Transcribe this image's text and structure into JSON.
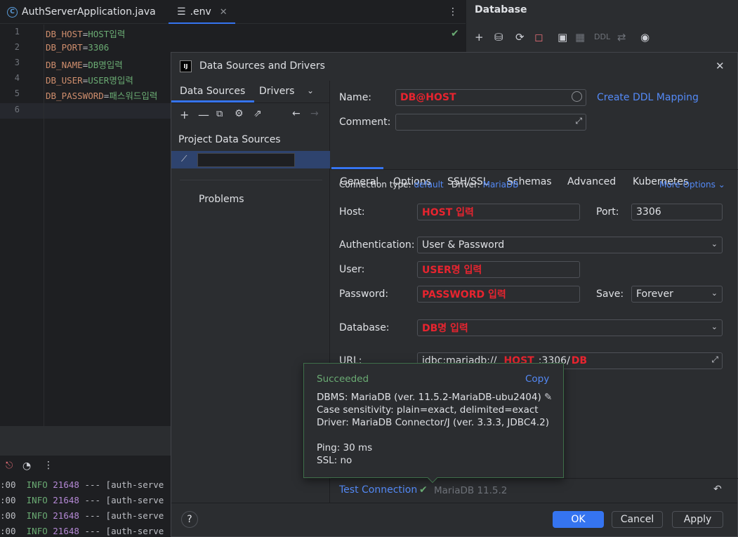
{
  "editor": {
    "tabs": [
      {
        "label": "AuthServerApplication.java"
      },
      {
        "label": ".env"
      }
    ],
    "lines": [
      {
        "num": "1",
        "key": "DB_HOST",
        "val": "HOST입력"
      },
      {
        "num": "2",
        "key": "DB_PORT",
        "val": "3306"
      },
      {
        "num": "3",
        "key": "DB_NAME",
        "val": "DB명입력"
      },
      {
        "num": "4",
        "key": "DB_USER",
        "val": "USER명입력"
      },
      {
        "num": "5",
        "key": "DB_PASSWORD",
        "val": "패스워드입력"
      },
      {
        "num": "6",
        "key": "",
        "val": ""
      }
    ],
    "eq": "="
  },
  "right_panel": {
    "title": "Database",
    "ddl": "DDL"
  },
  "log": [
    {
      "time": ":00",
      "level": "INFO",
      "pid": "21648",
      "rest": " --- [auth-serve"
    },
    {
      "time": ":00",
      "level": "INFO",
      "pid": "21648",
      "rest": " --- [auth-serve"
    },
    {
      "time": ":00",
      "level": "INFO",
      "pid": "21648",
      "rest": " --- [auth-serve"
    },
    {
      "time": ":00",
      "level": "INFO",
      "pid": "21648",
      "rest": " --- [auth-serve"
    }
  ],
  "dialog": {
    "title": "Data Sources and Drivers",
    "left": {
      "tab_sources": "Data Sources",
      "tab_drivers": "Drivers",
      "project_label": "Project Data Sources",
      "problems": "Problems"
    },
    "name_label": "Name:",
    "name_value": "DB@HOST",
    "create_ddl": "Create DDL Mapping",
    "comment_label": "Comment:",
    "tabs": [
      "General",
      "Options",
      "SSH/SSL",
      "Schemas",
      "Advanced",
      "Kubernetes"
    ],
    "conn_type_label": "Connection type:",
    "conn_type_value": "default",
    "driver_label": "Driver:",
    "driver_value": "MariaDB",
    "more_options": "More Options",
    "host_label": "Host:",
    "host_value": "HOST 입력",
    "port_label": "Port:",
    "port_value": "3306",
    "auth_label": "Authentication:",
    "auth_value": "User & Password",
    "user_label": "User:",
    "user_value": "USER명 입력",
    "password_label": "Password:",
    "password_value": "PASSWORD 입력",
    "save_label": "Save:",
    "save_value": "Forever",
    "database_label": "Database:",
    "database_value": "DB명 입력",
    "url_label": "URL:",
    "url_prefix": "jdbc:mariadb://",
    "url_host": "HOST",
    "url_port": ":3306/",
    "url_db": "DB",
    "test_connection": "Test Connection",
    "test_result": "MariaDB 11.5.2",
    "buttons": {
      "help": "?",
      "ok": "OK",
      "cancel": "Cancel",
      "apply": "Apply"
    }
  },
  "popup": {
    "status": "Succeeded",
    "copy": "Copy",
    "dbms": "DBMS: MariaDB (ver. 11.5.2-MariaDB-ubu2404)",
    "case": "Case sensitivity: plain=exact, delimited=exact",
    "driver": "Driver: MariaDB Connector/J (ver. 3.3.3, JDBC4.2)",
    "ping": "Ping: 30 ms",
    "ssl": "SSL: no"
  },
  "colors": {
    "accent": "#3574f0",
    "success": "#6aab73",
    "red": "#e8242f"
  }
}
